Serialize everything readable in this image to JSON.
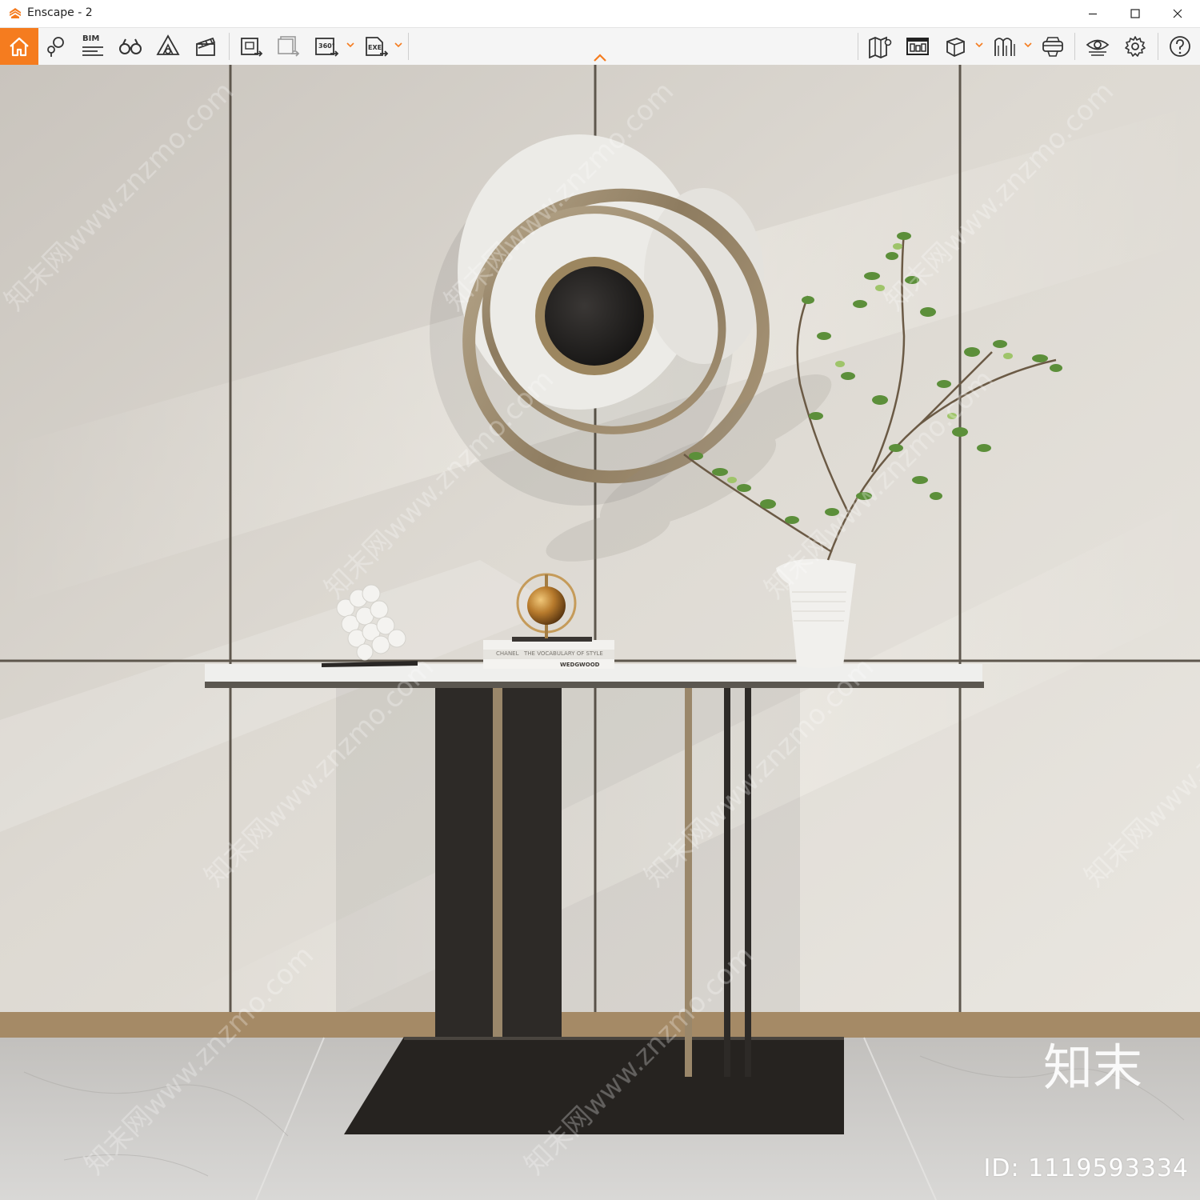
{
  "window": {
    "title": "Enscape - 2"
  },
  "toolbar": {
    "left_tools": [
      {
        "name": "home-icon"
      },
      {
        "name": "map-pin-icon"
      },
      {
        "name": "bim-icon",
        "label": "BIM"
      },
      {
        "name": "binoculars-icon"
      },
      {
        "name": "atmosphere-icon"
      },
      {
        "name": "clapperboard-icon"
      },
      {
        "name": "screenshot-export-icon"
      },
      {
        "name": "batch-render-icon"
      },
      {
        "name": "panorama-360-icon",
        "label": "360°"
      },
      {
        "name": "exe-export-icon",
        "label": "EXE"
      }
    ],
    "right_tools": [
      {
        "name": "map-icon"
      },
      {
        "name": "asset-library-icon"
      },
      {
        "name": "cube-icon"
      },
      {
        "name": "material-editor-icon"
      },
      {
        "name": "vr-headset-icon"
      },
      {
        "name": "visual-settings-eye-icon"
      },
      {
        "name": "settings-gear-icon"
      },
      {
        "name": "help-icon"
      }
    ],
    "accent": "#f57c1f"
  },
  "scene": {
    "watermark_text": "知末网www.znzmo.com",
    "book_text_1": "CHANEL",
    "book_text_2": "THE VOCABULARY OF STYLE",
    "book_text_3": "WEDGWOOD",
    "brand_logo": "知末",
    "image_id": "ID: 1119593334"
  }
}
